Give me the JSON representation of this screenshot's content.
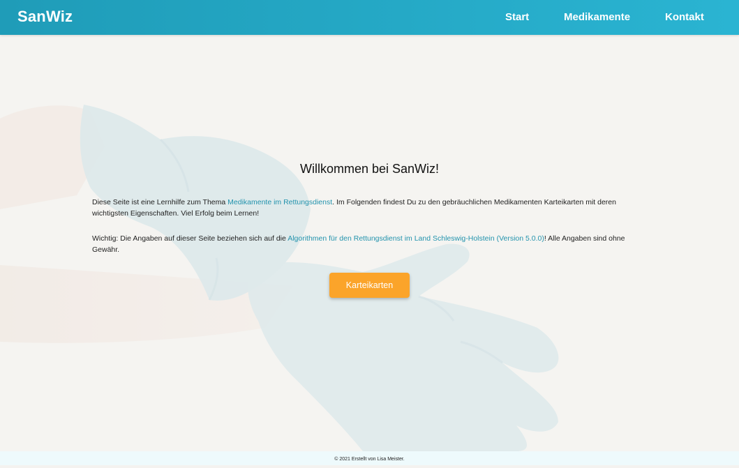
{
  "header": {
    "brand": "SanWiz",
    "nav": [
      "Start",
      "Medikamente",
      "Kontakt"
    ]
  },
  "main": {
    "title": "Willkommen bei SanWiz!",
    "intro": {
      "before": "Diese Seite ist eine Lernhilfe zum Thema ",
      "link": "Medikamente im Rettungsdienst",
      "after": ". Im Folgenden findest Du zu den gebräuchlichen Medikamenten Karteikarten mit deren wichtigsten Eigenschaften. Viel Erfolg beim Lernen!"
    },
    "notice": {
      "before": "Wichtig: Die Angaben auf dieser Seite beziehen sich auf die ",
      "link": "Algorithmen für den Rettungsdienst im Land Schleswig-Holstein (Version 5.0.0)",
      "after": "! Alle Angaben sind ohne Gewähr."
    },
    "button_label": "Karteikarten"
  },
  "footer": {
    "text": "© 2021 Erstellt von Lisa Meister."
  },
  "colors": {
    "nav_start": "#1f9cb8",
    "nav_end": "#2ab4d2",
    "link": "#2393ad",
    "button": "#fba42a",
    "footer_bg": "#eefafc"
  }
}
